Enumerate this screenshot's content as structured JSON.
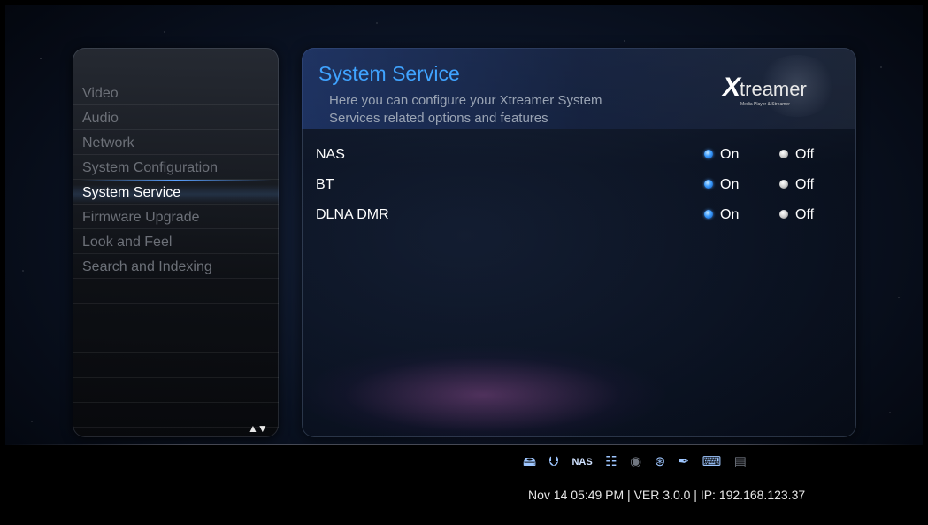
{
  "sidebar": {
    "items": [
      {
        "label": "Video",
        "active": false
      },
      {
        "label": "Audio",
        "active": false
      },
      {
        "label": "Network",
        "active": false
      },
      {
        "label": "System Configuration",
        "active": false
      },
      {
        "label": "System Service",
        "active": true
      },
      {
        "label": "Firmware Upgrade",
        "active": false
      },
      {
        "label": "Look and Feel",
        "active": false
      },
      {
        "label": "Search and Indexing",
        "active": false
      }
    ],
    "scroll_arrows": "▲▼"
  },
  "main": {
    "title": "System Service",
    "description_line1": "Here you can configure your Xtreamer System",
    "description_line2": "Services related options and features",
    "brand": {
      "logo_letter": "X",
      "logo_rest": "treamer",
      "tagline": "Media Player & Streamer"
    },
    "settings": [
      {
        "label": "NAS",
        "on_label": "On",
        "off_label": "Off",
        "value": "On"
      },
      {
        "label": "BT",
        "on_label": "On",
        "off_label": "Off",
        "value": "On"
      },
      {
        "label": "DLNA DMR",
        "on_label": "On",
        "off_label": "Off",
        "value": "On"
      }
    ]
  },
  "status_bar": {
    "icons": [
      "hdd-icon",
      "usb-icon",
      "nas-icon",
      "network-icon",
      "wifi-icon",
      "upnp-icon",
      "bluetooth-icon",
      "keyboard-icon",
      "sd-card-icon"
    ],
    "nas_text": "NAS",
    "info": "Nov 14 05:49 PM | VER 3.0.0 | IP: 192.168.123.37"
  },
  "colors": {
    "accent": "#3fa3ff",
    "selected_radio": "#3d9dff",
    "inactive_menu_text": "#6c7078"
  }
}
